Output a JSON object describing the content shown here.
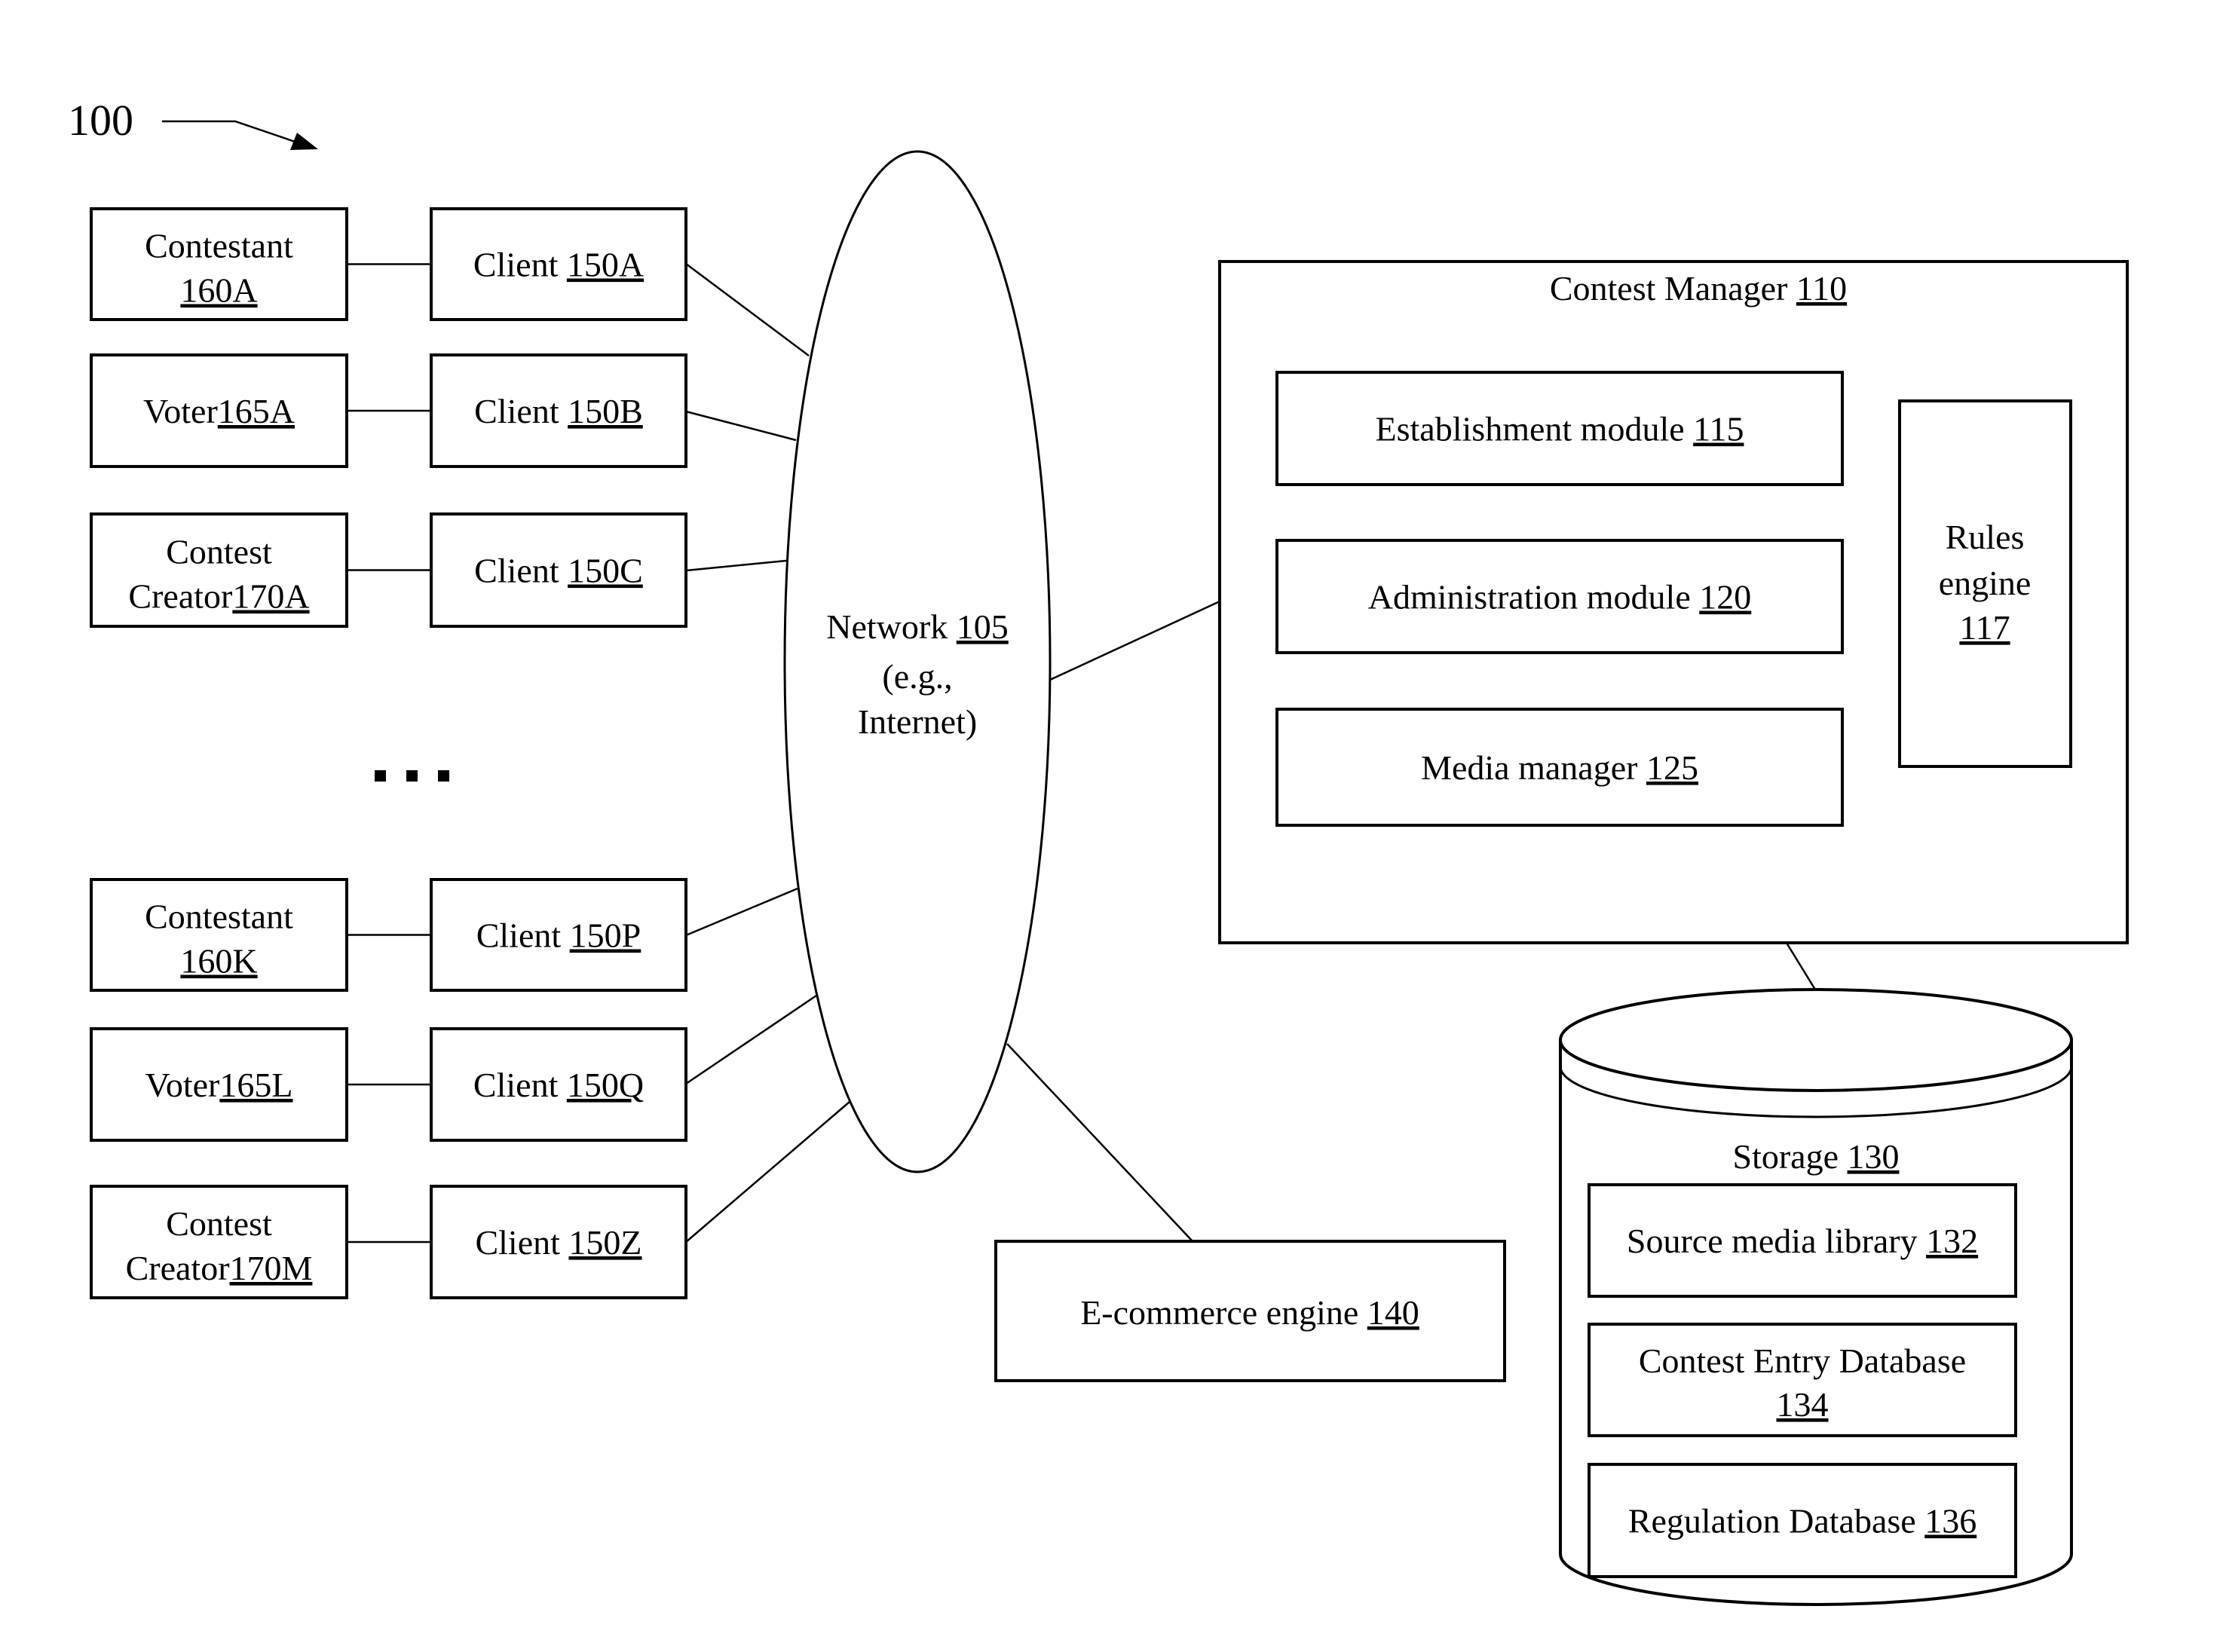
{
  "figure": {
    "reference_label": "100"
  },
  "left_column": {
    "actors": [
      {
        "lines": [
          {
            "text": "Contestant",
            "ref": ""
          },
          {
            "text": "",
            "ref": "160A"
          }
        ]
      },
      {
        "lines": [
          {
            "text": "Voter",
            "ref": "165A"
          }
        ]
      },
      {
        "lines": [
          {
            "text": "Contest",
            "ref": ""
          },
          {
            "text": "Creator",
            "ref": "170A"
          }
        ]
      },
      {
        "lines": [
          {
            "text": "Contestant",
            "ref": ""
          },
          {
            "text": "",
            "ref": "160K"
          }
        ]
      },
      {
        "lines": [
          {
            "text": "Voter",
            "ref": "165L"
          }
        ]
      },
      {
        "lines": [
          {
            "text": "Contest",
            "ref": ""
          },
          {
            "text": "Creator",
            "ref": "170M"
          }
        ]
      }
    ],
    "clients": [
      {
        "text": "Client ",
        "ref": "150A"
      },
      {
        "text": "Client ",
        "ref": "150B"
      },
      {
        "text": "Client ",
        "ref": "150C"
      },
      {
        "text": "Client ",
        "ref": "150P"
      },
      {
        "text": "Client ",
        "ref": "150Q"
      },
      {
        "text": "Client ",
        "ref": "150Z"
      }
    ],
    "ellipsis": "..."
  },
  "network": {
    "lines": [
      {
        "text": "Network ",
        "ref": "105"
      },
      {
        "text": "(e.g.,",
        "ref": ""
      },
      {
        "text": "Internet)",
        "ref": ""
      }
    ]
  },
  "contest_manager": {
    "title": {
      "text": "Contest Manager ",
      "ref": "110"
    },
    "modules": [
      {
        "text": "Establishment module ",
        "ref": "115"
      },
      {
        "text": "Administration module ",
        "ref": "120"
      },
      {
        "text": "Media manager ",
        "ref": "125"
      }
    ],
    "rules_engine": {
      "lines": [
        {
          "text": "Rules",
          "ref": ""
        },
        {
          "text": "engine",
          "ref": ""
        },
        {
          "text": "",
          "ref": "117"
        }
      ]
    }
  },
  "storage": {
    "title": {
      "text": "Storage ",
      "ref": "130"
    },
    "databases": [
      {
        "lines": [
          {
            "text": "Source media library ",
            "ref": "132"
          }
        ]
      },
      {
        "lines": [
          {
            "text": "Contest Entry Database",
            "ref": ""
          },
          {
            "text": "",
            "ref": "134"
          }
        ]
      },
      {
        "lines": [
          {
            "text": "Regulation Database ",
            "ref": "136"
          }
        ]
      }
    ]
  },
  "ecommerce": {
    "text": "E-commerce engine ",
    "ref": "140"
  }
}
